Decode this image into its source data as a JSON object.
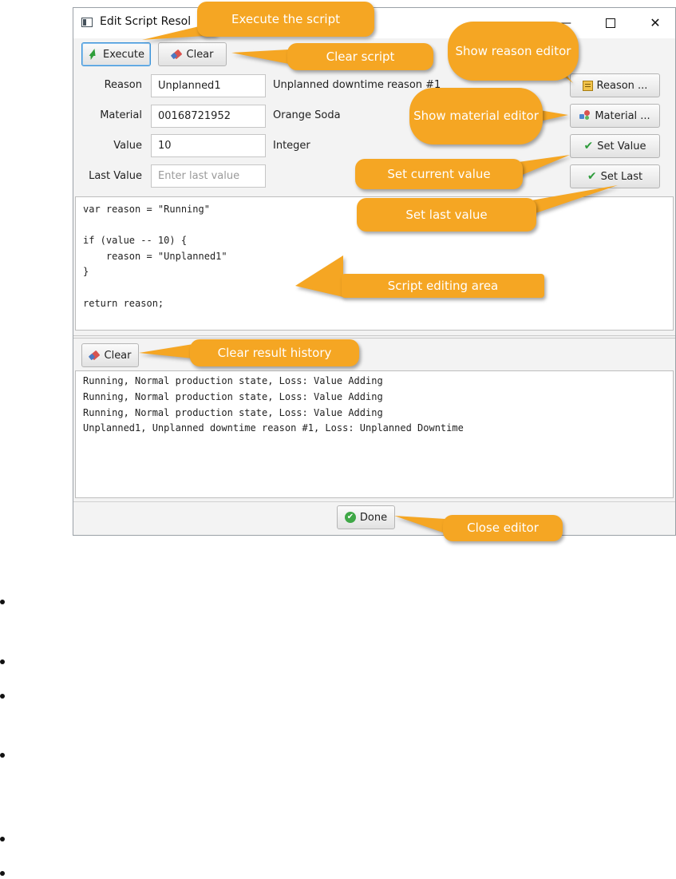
{
  "window": {
    "title": "Edit Script Resol",
    "minimize": "—",
    "close": "✕"
  },
  "toolbar": {
    "execute_label": "Execute",
    "clear_label": "Clear"
  },
  "fields": [
    {
      "label": "Reason",
      "value": "Unplanned1",
      "placeholder": "",
      "description": "Unplanned downtime reason #1"
    },
    {
      "label": "Material",
      "value": "00168721952",
      "placeholder": "",
      "description": "Orange Soda"
    },
    {
      "label": "Value",
      "value": "10",
      "placeholder": "",
      "description": "Integer"
    },
    {
      "label": "Last Value",
      "value": "",
      "placeholder": "Enter last value",
      "description": ""
    }
  ],
  "side_buttons": {
    "reason": "Reason ...",
    "material": "Material ...",
    "set_value": "Set Value",
    "set_last": "Set Last"
  },
  "script_lines": [
    "var reason = \"Running\"",
    "",
    "if (value -- 10) {",
    "    reason = \"Unplanned1\"",
    "}",
    "",
    "return reason;"
  ],
  "results": {
    "clear_label": "Clear",
    "lines": [
      "Running, Normal production state, Loss: Value Adding",
      "Running, Normal production state, Loss: Value Adding",
      "Running, Normal production state, Loss: Value Adding",
      "Unplanned1, Unplanned downtime reason #1, Loss: Unplanned Downtime"
    ]
  },
  "footer": {
    "done_label": "Done"
  },
  "callouts": {
    "execute": "Execute the script",
    "clear_script": "Clear script",
    "reason_editor": "Show reason editor",
    "material_editor": "Show material editor",
    "set_current": "Set current value",
    "set_last": "Set last value",
    "script_area": "Script editing area",
    "clear_history": "Clear result history",
    "close_editor": "Close editor"
  },
  "colors": {
    "callout": "#f5a623",
    "focus_border": "#3b93d8"
  },
  "icons": [
    "lightning-icon",
    "eraser-icon",
    "reason-icon",
    "material-icon",
    "check-icon",
    "done-icon"
  ]
}
